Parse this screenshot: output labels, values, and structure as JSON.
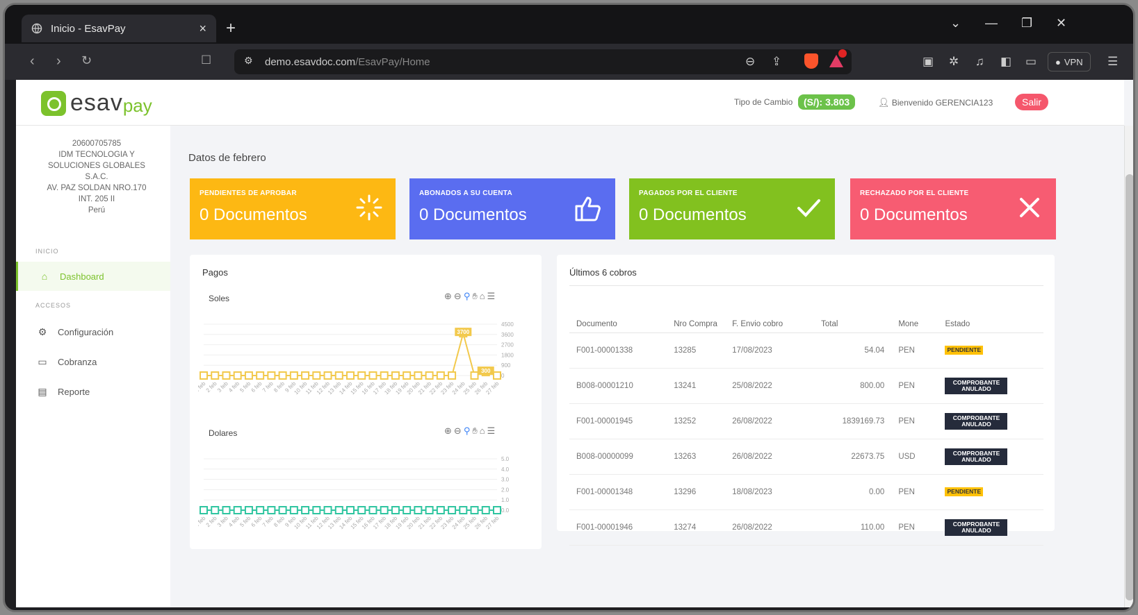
{
  "browser": {
    "tab_title": "Inicio - EsavPay",
    "url_host": "demo.esavdoc.com",
    "url_path": "/EsavPay/Home",
    "vpn_label": "VPN"
  },
  "header": {
    "logo_main": "esav",
    "logo_sub": "pay",
    "exchange_label": "Tipo de Cambio",
    "exchange_value": "(S/): 3.803",
    "welcome": "Bienvenido GERENCIA123",
    "logout": "Salir"
  },
  "sidebar": {
    "company_ruc": "20600705785",
    "company_name_1": "IDM TECNOLOGIA Y",
    "company_name_2": "SOLUCIONES GLOBALES",
    "company_name_3": "S.A.C.",
    "address_1": "AV. PAZ SOLDAN NRO.170",
    "address_2": "INT. 205 II",
    "country": "Perú",
    "section_inicio": "INICIO",
    "section_accesos": "ACCESOS",
    "items": [
      {
        "label": "Dashboard",
        "icon": "home-icon"
      },
      {
        "label": "Configuración",
        "icon": "gear-icon"
      },
      {
        "label": "Cobranza",
        "icon": "card-icon"
      },
      {
        "label": "Reporte",
        "icon": "report-icon"
      }
    ]
  },
  "main": {
    "title": "Datos de febrero",
    "cards": [
      {
        "label": "PENDIENTES DE APROBAR",
        "value": "0 Documentos",
        "color": "#fdb813",
        "icon": "loader-icon"
      },
      {
        "label": "ABONADOS A SU CUENTA",
        "value": "0 Documentos",
        "color": "#5a6df0",
        "icon": "thumbs-up-icon"
      },
      {
        "label": "PAGADOS POR EL CLIENTE",
        "value": "0 Documentos",
        "color": "#82c11f",
        "icon": "check-icon"
      },
      {
        "label": "RECHAZADO POR EL CLIENTE",
        "value": "0 Documentos",
        "color": "#f75c72",
        "icon": "x-icon"
      }
    ]
  },
  "pagos": {
    "title": "Pagos",
    "chart_data": [
      {
        "type": "line",
        "title": "Soles",
        "color": "#f2c94c",
        "x": [
          "1 feb",
          "2 feb",
          "3 feb",
          "4 feb",
          "5 feb",
          "6 feb",
          "7 feb",
          "8 feb",
          "9 feb",
          "10 feb",
          "11 feb",
          "12 feb",
          "13 feb",
          "14 feb",
          "15 feb",
          "16 feb",
          "17 feb",
          "18 feb",
          "19 feb",
          "20 feb",
          "21 feb",
          "22 feb",
          "23 feb",
          "24 feb",
          "25 feb",
          "26 feb",
          "27 feb"
        ],
        "values": [
          0,
          0,
          0,
          0,
          0,
          0,
          0,
          0,
          0,
          0,
          0,
          0,
          0,
          0,
          0,
          0,
          0,
          0,
          0,
          0,
          0,
          0,
          0,
          3700,
          0,
          300,
          0
        ],
        "data_labels": {
          "23": "3700",
          "25": "300"
        },
        "yticks": [
          "4500",
          "3600",
          "2700",
          "1800",
          "900",
          "0"
        ],
        "ylim": [
          0,
          4500
        ]
      },
      {
        "type": "line",
        "title": "Dolares",
        "color": "#2fc5a0",
        "x": [
          "1 feb",
          "2 feb",
          "3 feb",
          "4 feb",
          "5 feb",
          "6 feb",
          "7 feb",
          "8 feb",
          "9 feb",
          "10 feb",
          "11 feb",
          "12 feb",
          "13 feb",
          "14 feb",
          "15 feb",
          "16 feb",
          "17 feb",
          "18 feb",
          "19 feb",
          "20 feb",
          "21 feb",
          "22 feb",
          "23 feb",
          "24 feb",
          "25 feb",
          "26 feb",
          "27 feb"
        ],
        "values": [
          0,
          0,
          0,
          0,
          0,
          0,
          0,
          0,
          0,
          0,
          0,
          0,
          0,
          0,
          0,
          0,
          0,
          0,
          0,
          0,
          0,
          0,
          0,
          0,
          0,
          0,
          0
        ],
        "data_labels": {},
        "yticks": [
          "5.0",
          "4.0",
          "3.0",
          "2.0",
          "1.0",
          "0.0"
        ],
        "ylim": [
          0,
          5
        ]
      }
    ]
  },
  "cobros": {
    "title": "Últimos 6 cobros",
    "headers": [
      "Documento",
      "Nro Compra",
      "F. Envio cobro",
      "Total",
      "Mone",
      "Estado"
    ],
    "rows": [
      {
        "doc": "F001-00001338",
        "compra": "13285",
        "fecha": "17/08/2023",
        "total": "54.04",
        "mone": "PEN",
        "estado": "PENDIENTE",
        "tipo": "pend"
      },
      {
        "doc": "B008-00001210",
        "compra": "13241",
        "fecha": "25/08/2022",
        "total": "800.00",
        "mone": "PEN",
        "estado": "COMPROBANTE ANULADO",
        "tipo": "anul"
      },
      {
        "doc": "F001-00001945",
        "compra": "13252",
        "fecha": "26/08/2022",
        "total": "1839169.73",
        "mone": "PEN",
        "estado": "COMPROBANTE ANULADO",
        "tipo": "anul"
      },
      {
        "doc": "B008-00000099",
        "compra": "13263",
        "fecha": "26/08/2022",
        "total": "22673.75",
        "mone": "USD",
        "estado": "COMPROBANTE ANULADO",
        "tipo": "anul"
      },
      {
        "doc": "F001-00001348",
        "compra": "13296",
        "fecha": "18/08/2023",
        "total": "0.00",
        "mone": "PEN",
        "estado": "PENDIENTE",
        "tipo": "pend"
      },
      {
        "doc": "F001-00001946",
        "compra": "13274",
        "fecha": "26/08/2022",
        "total": "110.00",
        "mone": "PEN",
        "estado": "COMPROBANTE ANULADO",
        "tipo": "anul"
      }
    ]
  }
}
